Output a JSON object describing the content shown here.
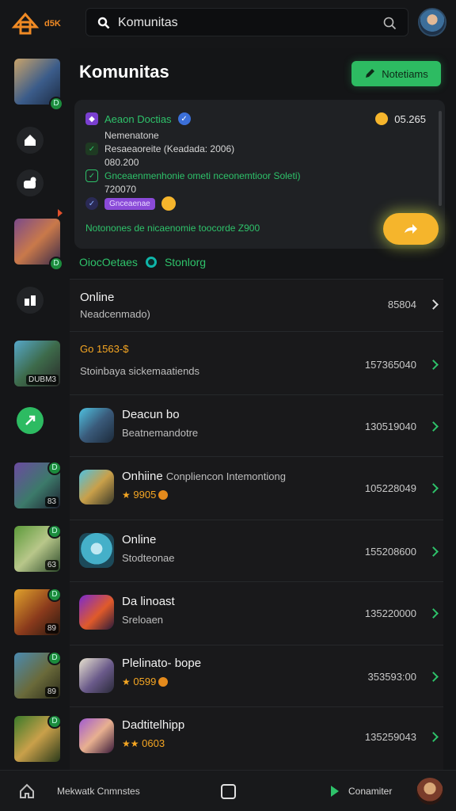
{
  "app": {
    "logo_text": "d5K"
  },
  "search": {
    "value": "Komunitas"
  },
  "page": {
    "title": "Komunitas"
  },
  "header": {
    "notif_label": "Notetiams"
  },
  "card": {
    "row1": "Aeaon Doctias",
    "row1_value": "05.265",
    "row2": "Nemenatone",
    "row3": "Resaeaoreite (Keadada: 2006)",
    "row4": "080.200",
    "row5": "Gnceaenmenhonie ometi nceonemtioor Soleti)",
    "row6": "720070",
    "row7_tag": "Gnceaenae",
    "row8": "Notonones de nicaenomie toocorde Z900"
  },
  "filters": {
    "left": "OiocOetaes",
    "right": "Stonlorg"
  },
  "list": {
    "rows": [
      {
        "title": "Online",
        "sub": "Neadcenmado)",
        "num": "85804"
      },
      {
        "title": "Go 1563-$",
        "sub": "Stoinbaya sickemaatiends",
        "num": "157365040"
      },
      {
        "title": "Deacun bo",
        "sub": "Beatnemandotre",
        "num": "130519040"
      },
      {
        "title": "Onhiine",
        "title_extra": "Conpliencon Intemontiong",
        "sub": "9905",
        "num": "105228049"
      },
      {
        "title": "Online",
        "sub": "Stodteonae",
        "num": "155208600"
      },
      {
        "title": "Da linoast",
        "sub": "Sreloaen",
        "num": "135220000"
      },
      {
        "title": "Plelinato- bope",
        "sub": "0599",
        "num": "353593:00"
      },
      {
        "title": "Dadtitelhipp",
        "sub": "0603",
        "num": "135259043"
      }
    ]
  },
  "sidebar": {
    "counts": [
      "DUBM3",
      "83",
      "63",
      "89",
      "89"
    ]
  },
  "bottombar": {
    "left_label": "Mekwatk Cnmnstes",
    "right_label": "Conamiter"
  },
  "colors": {
    "accent_green": "#2dbb62",
    "accent_orange": "#f5b52c",
    "background": "#141517"
  }
}
